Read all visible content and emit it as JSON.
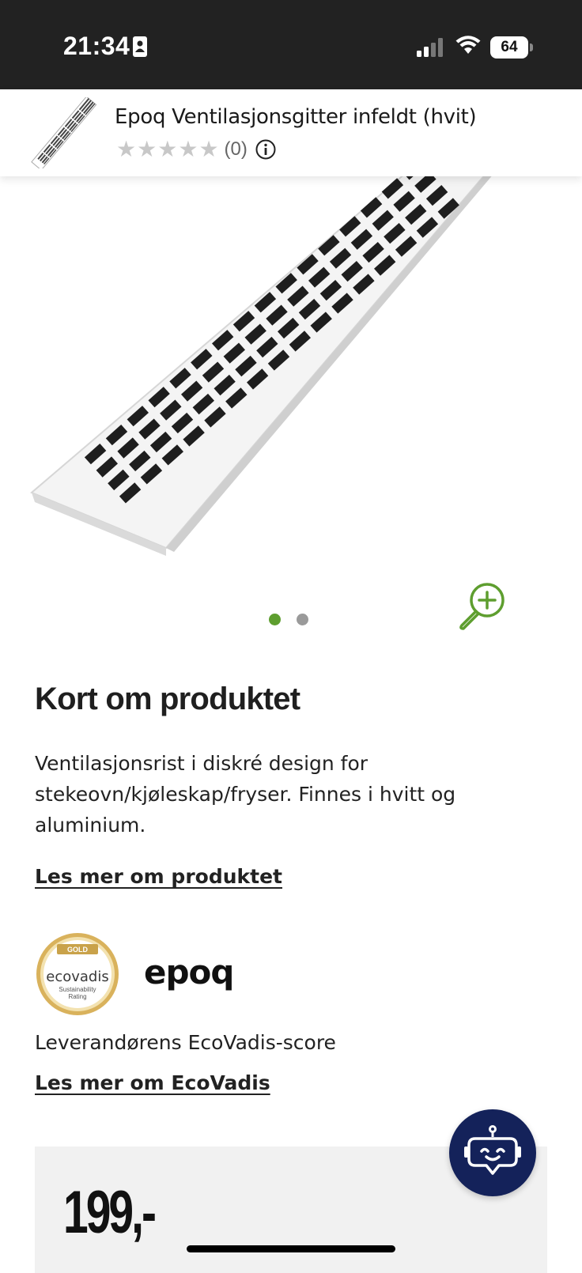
{
  "status_bar": {
    "time": "21:34",
    "battery": "64",
    "icons": [
      "contact-card-icon",
      "signal-icon",
      "wifi-icon",
      "battery-icon"
    ]
  },
  "header": {
    "product_title": "Epoq Ventilasjonsgitter infeldt (hvit)",
    "rating_count": "(0)",
    "stars_filled": 0,
    "stars_total": 5
  },
  "gallery": {
    "image_count": 2,
    "active_index": 0
  },
  "about": {
    "title": "Kort om produktet",
    "description": "Ventilasjonsrist i diskré design for stekeovn/kjøleskap/fryser. Finnes i hvitt og aluminium.",
    "read_more": "Les mer om produktet"
  },
  "ecovadis": {
    "badge_level": "GOLD",
    "badge_brand": "ecovadis",
    "badge_sub1": "Sustainability",
    "badge_sub2": "Rating",
    "supplier_logo": "epoq",
    "caption": "Leverandørens EcoVadis-score",
    "read_more": "Les mer om EcoVadis"
  },
  "price": {
    "value": "199,-"
  },
  "colors": {
    "accent_green": "#5e9e2f",
    "chat_navy": "#14225a",
    "status_bar_bg": "#222222",
    "gold": "#c9a24a"
  }
}
